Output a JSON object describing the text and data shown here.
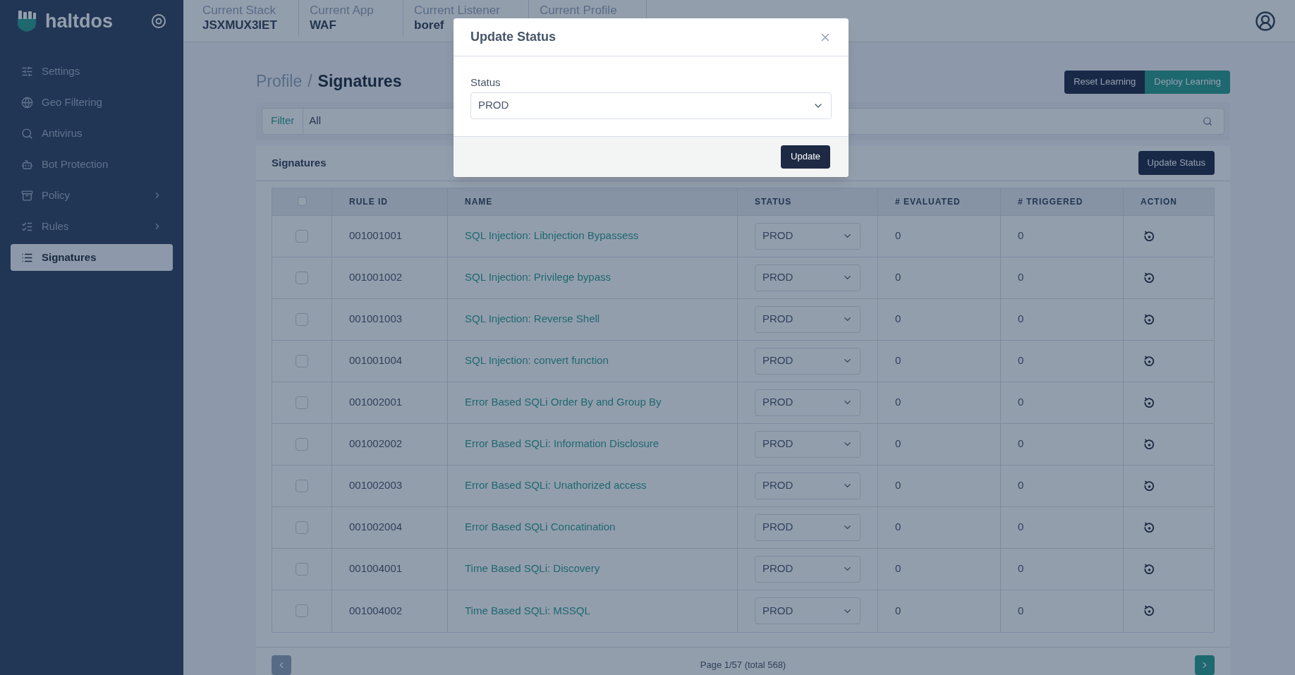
{
  "brand": {
    "name": "haltdos"
  },
  "sidebar": {
    "items": [
      {
        "label": "Settings",
        "expandable": false,
        "selected": false
      },
      {
        "label": "Geo Filtering",
        "expandable": false,
        "selected": false
      },
      {
        "label": "Antivirus",
        "expandable": false,
        "selected": false
      },
      {
        "label": "Bot Protection",
        "expandable": false,
        "selected": false
      },
      {
        "label": "Policy",
        "expandable": true,
        "selected": false
      },
      {
        "label": "Rules",
        "expandable": true,
        "selected": false
      },
      {
        "label": "Signatures",
        "expandable": false,
        "selected": true
      }
    ]
  },
  "context_bar": [
    {
      "label": "Current Stack",
      "value": "JSXMUX3IET"
    },
    {
      "label": "Current App",
      "value": "WAF"
    },
    {
      "label": "Current Listener",
      "value": "boref"
    },
    {
      "label": "Current Profile"
    }
  ],
  "breadcrumb": {
    "parent": "Profile",
    "separator": "/",
    "current": "Signatures"
  },
  "actions": [
    {
      "label": "Reset Learning",
      "kind": "dark"
    },
    {
      "label": "Deploy Learning",
      "kind": "teal"
    }
  ],
  "filter": {
    "label": "Filter",
    "value": "All"
  },
  "panel": {
    "title": "Signatures",
    "button": "Update Status"
  },
  "table": {
    "header_checked": false,
    "columns": [
      "RULE ID",
      "NAME",
      "STATUS",
      "# EVALUATED",
      "# TRIGGERED",
      "ACTION"
    ],
    "rows": [
      {
        "checked": false,
        "rule_id": "001001001",
        "name": "SQL Injection: Libnjection Bypassess",
        "status": "PROD",
        "evaluated": "0",
        "triggered": "0"
      },
      {
        "checked": false,
        "rule_id": "001001002",
        "name": "SQL Injection: Privilege bypass",
        "status": "PROD",
        "evaluated": "0",
        "triggered": "0"
      },
      {
        "checked": false,
        "rule_id": "001001003",
        "name": "SQL Injection: Reverse Shell",
        "status": "PROD",
        "evaluated": "0",
        "triggered": "0"
      },
      {
        "checked": false,
        "rule_id": "001001004",
        "name": "SQL Injection: convert function",
        "status": "PROD",
        "evaluated": "0",
        "triggered": "0"
      },
      {
        "checked": false,
        "rule_id": "001002001",
        "name": "Error Based SQLi Order By and Group By",
        "status": "PROD",
        "evaluated": "0",
        "triggered": "0"
      },
      {
        "checked": false,
        "rule_id": "001002002",
        "name": "Error Based SQLi: Information Disclosure",
        "status": "PROD",
        "evaluated": "0",
        "triggered": "0"
      },
      {
        "checked": false,
        "rule_id": "001002003",
        "name": "Error Based SQLi: Unathorized access",
        "status": "PROD",
        "evaluated": "0",
        "triggered": "0"
      },
      {
        "checked": false,
        "rule_id": "001002004",
        "name": "Error Based SQLi Concatination",
        "status": "PROD",
        "evaluated": "0",
        "triggered": "0"
      },
      {
        "checked": false,
        "rule_id": "001004001",
        "name": "Time Based SQLi: Discovery",
        "status": "PROD",
        "evaluated": "0",
        "triggered": "0"
      },
      {
        "checked": false,
        "rule_id": "001004002",
        "name": "Time Based SQLi: MSSQL",
        "status": "PROD",
        "evaluated": "0",
        "triggered": "0"
      }
    ]
  },
  "pagination": {
    "text": "Page 1/57 (total 568)",
    "prev_disabled": true,
    "next_disabled": false
  },
  "dialog": {
    "title": "Update Status",
    "field_label": "Status",
    "field_value": "PROD",
    "button": "Update"
  }
}
